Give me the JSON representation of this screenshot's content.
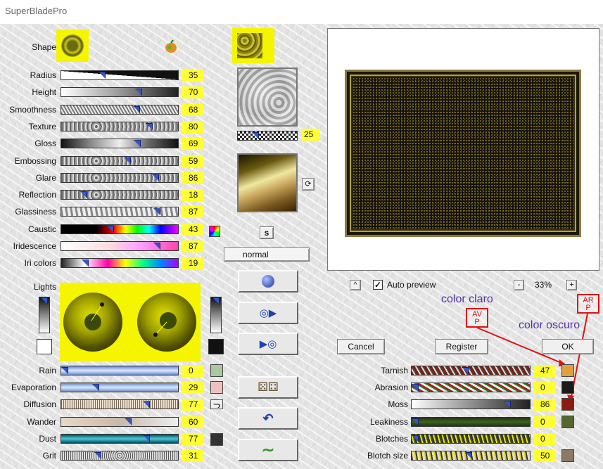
{
  "window": {
    "title": "SuperBladePro"
  },
  "shape": {
    "label": "Shape"
  },
  "sliders_left": [
    {
      "label": "Radius",
      "value": "35",
      "level": 0.35,
      "style": "radius"
    },
    {
      "label": "Height",
      "value": "70",
      "level": 0.7,
      "style": "height"
    },
    {
      "label": "Smoothness",
      "value": "68",
      "level": 0.68,
      "style": "smooth"
    },
    {
      "label": "Texture",
      "value": "80",
      "level": 0.8,
      "style": "tex"
    },
    {
      "label": "Gloss",
      "value": "69",
      "level": 0.69,
      "style": "gloss"
    },
    {
      "label": "Embossing",
      "value": "59",
      "level": 0.59,
      "style": "tex"
    },
    {
      "label": "Glare",
      "value": "86",
      "level": 0.86,
      "style": "tex"
    },
    {
      "label": "Reflection",
      "value": "18",
      "level": 0.18,
      "style": "tex"
    },
    {
      "label": "Glassiness",
      "value": "87",
      "level": 0.87,
      "style": "glass"
    },
    {
      "label": "Caustic",
      "value": "43",
      "level": 0.43,
      "style": "caustic"
    },
    {
      "label": "Iridescence",
      "value": "87",
      "level": 0.87,
      "style": "irid"
    },
    {
      "label": "Iri colors",
      "value": "19",
      "level": 0.19,
      "style": "iricolors"
    }
  ],
  "texture_scale": {
    "value": "25",
    "level": 0.25
  },
  "blend_mode": "normal",
  "lights": {
    "label": "Lights"
  },
  "sliders_bottom_left": [
    {
      "label": "Rain",
      "value": "0",
      "level": 0.0,
      "style": "rain"
    },
    {
      "label": "Evaporation",
      "value": "29",
      "level": 0.29,
      "style": "rain"
    },
    {
      "label": "Diffusion",
      "value": "77",
      "level": 0.77,
      "style": "diff"
    },
    {
      "label": "Wander",
      "value": "60",
      "level": 0.6,
      "style": "wander"
    },
    {
      "label": "Dust",
      "value": "77",
      "level": 0.77,
      "style": "dust"
    },
    {
      "label": "Grit",
      "value": "31",
      "level": 0.31,
      "style": "grit"
    }
  ],
  "sliders_bottom_right": [
    {
      "label": "Tarnish",
      "value": "47",
      "level": 0.47,
      "color": "#e0a040"
    },
    {
      "label": "Abrasion",
      "value": "0",
      "level": 0.0,
      "color": "#1a1a1a"
    },
    {
      "label": "Moss",
      "value": "86",
      "level": 0.86,
      "color": "#8a1c10"
    },
    {
      "label": "Leakiness",
      "value": "0",
      "level": 0.0,
      "color": "#556633"
    },
    {
      "label": "Blotches",
      "value": "0",
      "level": 0.0,
      "color": ""
    },
    {
      "label": "Blotch size",
      "value": "50",
      "level": 0.5,
      "color": "#8c7a66"
    }
  ],
  "preview": {
    "auto_preview_label": "Auto preview",
    "auto_preview_checked": true,
    "zoom": "33%",
    "zoom_out": "-",
    "zoom_in": "+",
    "scroll_up": "^"
  },
  "buttons": {
    "cancel": "Cancel",
    "register": "Register",
    "ok": "OK",
    "s_button": "s"
  },
  "annotations": {
    "color_claro": "color claro",
    "color_oscuro": "color oscuro",
    "avp": "AV\nP",
    "arp": "AR\nP"
  },
  "colors": {
    "highlight": "#f5f500",
    "annotation_text": "#5533aa",
    "annotation_red": "#e01010",
    "frame_gold": "#8a7a40"
  }
}
